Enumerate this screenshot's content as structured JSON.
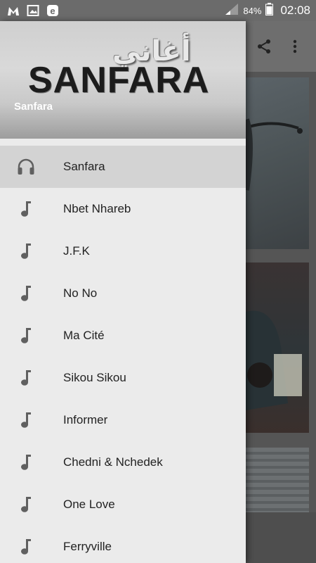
{
  "status_bar": {
    "left_icons": [
      "malwarebytes-icon",
      "image-icon",
      "e-icon"
    ],
    "battery_percent": "84%",
    "time": "02:08"
  },
  "header": {
    "logo_arabic": "أغاني",
    "logo_english": "SANFARA",
    "name": "Sanfara"
  },
  "menu": {
    "items": [
      {
        "label": "Sanfara",
        "icon": "headphones-icon",
        "active": true
      },
      {
        "label": "Nbet Nhareb",
        "icon": "music-note-icon"
      },
      {
        "label": "J.F.K",
        "icon": "music-note-icon"
      },
      {
        "label": "No No",
        "icon": "music-note-icon"
      },
      {
        "label": "Ma Cité",
        "icon": "music-note-icon"
      },
      {
        "label": "Sikou Sikou",
        "icon": "music-note-icon"
      },
      {
        "label": "Informer",
        "icon": "music-note-icon"
      },
      {
        "label": "Chedni & Nchedek",
        "icon": "music-note-icon"
      },
      {
        "label": "One Love",
        "icon": "music-note-icon"
      },
      {
        "label": "Ferryville",
        "icon": "music-note-icon"
      }
    ]
  },
  "appbar_actions": [
    "share-icon",
    "more-vert-icon"
  ],
  "colors": {
    "icon": "#606060",
    "drawer_bg": "#ebebeb",
    "active_bg": "#d3d3d3"
  }
}
